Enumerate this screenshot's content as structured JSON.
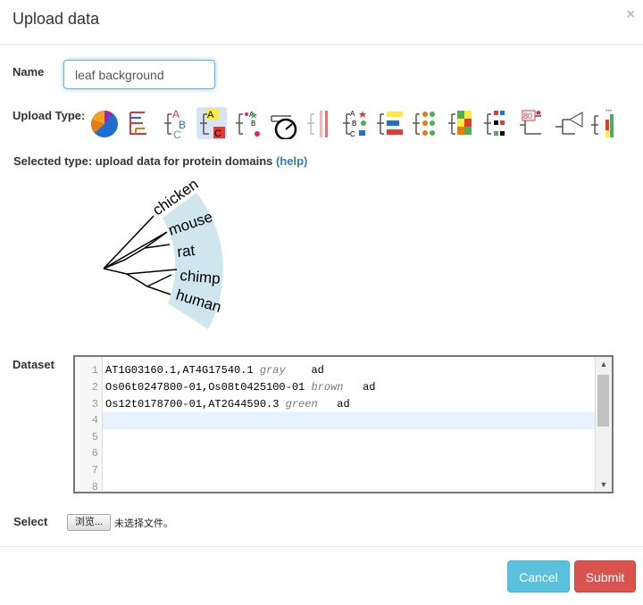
{
  "dialog": {
    "title": "Upload data",
    "close_glyph": "×"
  },
  "form": {
    "name_label": "Name",
    "name_value": "leaf background",
    "upload_type_label": "Upload Type:",
    "selected_type_prefix": "Selected type: upload data for protein domains",
    "help_link": "(help)",
    "dataset_label": "Dataset",
    "select_label": "Select",
    "file_button": "浏览...",
    "file_status": "未选择文件。"
  },
  "upload_types": [
    {
      "icon": "pie-chart-icon"
    },
    {
      "icon": "branch-color-icon"
    },
    {
      "icon": "leaf-label-color-icon"
    },
    {
      "icon": "leaf-background-icon",
      "selected": true
    },
    {
      "icon": "leaf-decoration-icon"
    },
    {
      "icon": "time-icon"
    },
    {
      "icon": "strips-icon"
    },
    {
      "icon": "protein-domains-icon"
    },
    {
      "icon": "bars-icon"
    },
    {
      "icon": "dots-icon"
    },
    {
      "icon": "heatmap-icon"
    },
    {
      "icon": "binary-icon"
    },
    {
      "icon": "bootstrap-icon"
    },
    {
      "icon": "collapse-icon"
    },
    {
      "icon": "multi-bar-icon"
    }
  ],
  "preview": {
    "leaves": [
      "chicken",
      "mouse",
      "rat",
      "chimp",
      "human"
    ],
    "highlight_color": "#d0e6ee"
  },
  "dataset": {
    "lines": [
      {
        "num": "1",
        "ids": "AT1G03160.1,AT4G17540.1",
        "color": "gray",
        "tag": "ad"
      },
      {
        "num": "2",
        "ids": "Os06t0247800-01,Os08t0425100-01",
        "color": "brown",
        "tag": "ad"
      },
      {
        "num": "3",
        "ids": "Os12t0178700-01,AT2G44590.3",
        "color": "green",
        "tag": "ad"
      },
      {
        "num": "4",
        "ids": "",
        "color": "",
        "tag": ""
      },
      {
        "num": "5",
        "ids": "",
        "color": "",
        "tag": ""
      },
      {
        "num": "6",
        "ids": "",
        "color": "",
        "tag": ""
      },
      {
        "num": "7",
        "ids": "",
        "color": "",
        "tag": ""
      },
      {
        "num": "8",
        "ids": "",
        "color": "",
        "tag": ""
      }
    ]
  },
  "buttons": {
    "cancel": "Cancel",
    "submit": "Submit"
  },
  "colors": {
    "cancel": "#5bc0de",
    "submit": "#d9534f",
    "link": "#337ab7",
    "input_focus": "#66afe9"
  }
}
